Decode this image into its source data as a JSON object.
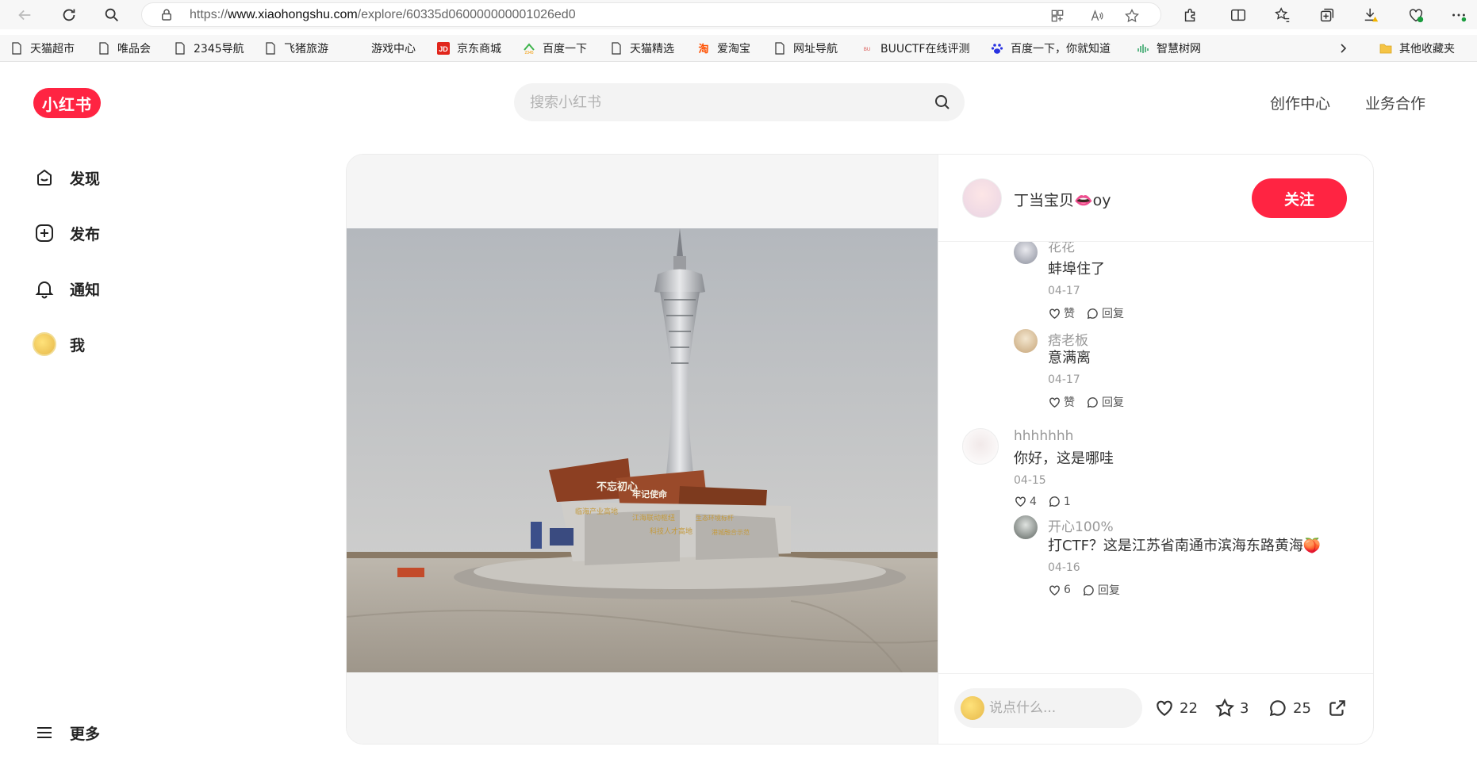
{
  "browser": {
    "url_prefix": "https://",
    "url_host": "www.xiaohongshu.com",
    "url_path": "/explore/60335d060000000001026ed0"
  },
  "bookmarks": [
    {
      "label": "天猫超市",
      "icon": "page-icon"
    },
    {
      "label": "唯品会",
      "icon": "page-icon"
    },
    {
      "label": "2345导航",
      "icon": "page-icon"
    },
    {
      "label": "飞猪旅游",
      "icon": "page-icon"
    },
    {
      "label": "游戏中心",
      "icon": "none"
    },
    {
      "label": "京东商城",
      "icon": "jd-logo-icon"
    },
    {
      "label": "百度一下",
      "icon": "2345-logo-icon"
    },
    {
      "label": "天猫精选",
      "icon": "page-icon"
    },
    {
      "label": "爱淘宝",
      "icon": "taobao-logo-icon"
    },
    {
      "label": "网址导航",
      "icon": "page-icon"
    },
    {
      "label": "BUUCTF在线评测",
      "icon": "buuctf-logo-icon"
    },
    {
      "label": "百度一下，你就知道",
      "icon": "baidu-paw-icon"
    },
    {
      "label": "智慧树网",
      "icon": "zhihuishu-logo-icon"
    },
    {
      "label": "其他收藏夹",
      "icon": "folder-icon"
    }
  ],
  "site": {
    "logo_text": "小红书",
    "search_placeholder": "搜索小红书",
    "header_links": [
      "创作中心",
      "业务合作"
    ]
  },
  "left_nav": [
    {
      "label": "发现",
      "icon": "home-icon"
    },
    {
      "label": "发布",
      "icon": "plus-square-icon"
    },
    {
      "label": "通知",
      "icon": "bell-icon"
    },
    {
      "label": "我",
      "icon": "avatar"
    }
  ],
  "more_label": "更多",
  "note": {
    "author": "丁当宝贝👄oy",
    "follow_label": "关注",
    "photo_texts": [
      "不忘初心",
      "牢记使命",
      "临海产业高地",
      "江海联动枢纽",
      "生态环境标杆",
      "科技人才高地",
      "港城融合示范"
    ],
    "comments": [
      {
        "user": "花花",
        "text": "蚌埠住了",
        "date": "04-17",
        "like_label": "赞",
        "reply_label": "回复"
      },
      {
        "user": "痞老板",
        "text": "意满离",
        "date": "04-17",
        "like_label": "赞",
        "reply_label": "回复"
      },
      {
        "user": "hhhhhhh",
        "text": "你好，这是哪哇",
        "date": "04-15",
        "likes": "4",
        "replies": "1"
      },
      {
        "user": "开心100%",
        "text": "打CTF？这是江苏省南通市滨海东路黄海🍑",
        "date": "04-16",
        "likes": "6",
        "reply_label": "回复"
      }
    ],
    "comment_placeholder": "说点什么...",
    "likes": "22",
    "collects": "3",
    "comments_count": "25"
  }
}
